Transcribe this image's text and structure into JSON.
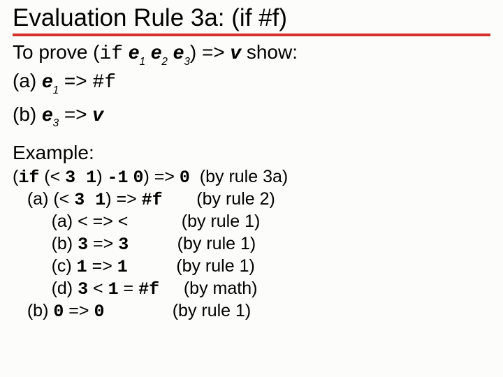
{
  "title": "Evaluation Rule 3a:  (if #f)",
  "prove": {
    "lead": "To prove (",
    "ifkw": "if",
    "sp": " ",
    "e": "e",
    "s1": "1",
    "s2": "2",
    "s3": "3",
    "close": ") => ",
    "v": "v",
    "show": " show:"
  },
  "a": {
    "label": "(a) ",
    "e": "e",
    "s": "1",
    "arrow": " => ",
    "val": "#f"
  },
  "b": {
    "label": "(b) ",
    "e": "e",
    "s": "3",
    "arrow": " => ",
    "v": "v"
  },
  "exhead": "Example:",
  "ex": {
    "l1": {
      "open": "(",
      "ifkw": "if",
      "rest1": " (< ",
      "n31": "3 1",
      "rest2": ") ",
      "neg1": "-1",
      "sp": " ",
      "zero": "0",
      "close": ") => ",
      "res": "0",
      "note": "  (by rule 3a)"
    },
    "l2": {
      "pre": "   (a) (< ",
      "n31": "3 1",
      "rest": ") => ",
      "val": "#f",
      "note": "       (by rule 2)"
    },
    "l3": {
      "pre": "        (a) < => <",
      "note": "           (by rule 1)"
    },
    "l4": {
      "pre": "        (b) ",
      "a": "3",
      "mid": " => ",
      "b": "3",
      "note": "          (by rule 1)"
    },
    "l5": {
      "pre": "        (c) ",
      "a": "1",
      "mid": " => ",
      "b": "1",
      "note": "          (by rule 1)"
    },
    "l6": {
      "pre": "        (d) ",
      "a": "3",
      "lt": " < ",
      "b": "1",
      "eq": " = ",
      "val": "#f",
      "note": "     (by math)"
    },
    "l7": {
      "pre": "   (b) ",
      "a": "0",
      "mid": " => ",
      "b": "0",
      "note": "              (by rule 1)"
    }
  }
}
